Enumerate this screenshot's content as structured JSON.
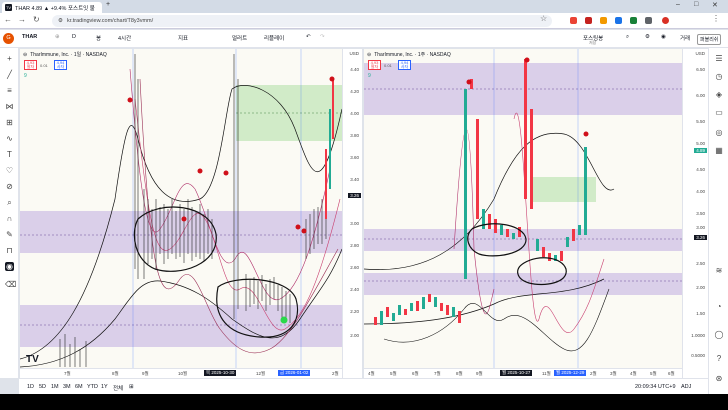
{
  "browser": {
    "tab_title": "THAR 4.89 ▲ +9.4% 포스트잇 불",
    "tab_favicon": "TV",
    "url": "kr.tradingview.com/chart/T8y3vmm/"
  },
  "toolbar": {
    "avatar": "G",
    "symbol": "THAR",
    "interval": "D",
    "candles_label": "봉",
    "compare_label": "4시간",
    "indicators_label": "지표",
    "alerts_label": "얼러트",
    "replay_label": "리플레이",
    "layout_label": "포스팅봉",
    "layout_sub": "저장",
    "trade_label": "거래",
    "publish_label": "퍼블리쉬"
  },
  "left_chart": {
    "title": "TharImmune, Inc. · 1일 · NASDAQ",
    "sell_price": "4.93",
    "sell_label": "팔자",
    "spread": "0.01",
    "buy_price": "4.94",
    "buy_label": "사자",
    "volume": "9",
    "currency": "USD",
    "y_ticks": [
      "4.40",
      "4.20",
      "4.00",
      "3.80",
      "3.60",
      "3.40",
      "3.26",
      "3.00",
      "2.80",
      "2.60",
      "2.40",
      "2.20",
      "2.00"
    ],
    "price_tag": "3.26",
    "x_ticks": [
      "7월",
      "8월",
      "9월",
      "10월",
      "12월",
      "2월"
    ],
    "x_highlight_1": "목 2025-10-30",
    "x_highlight_2": "금 2026-01-02"
  },
  "right_chart": {
    "title": "TharImmune, Inc. · 1주 · NASDAQ",
    "sell_price": "4.93",
    "sell_label": "팔자",
    "spread": "0.01",
    "buy_price": "4.94",
    "buy_label": "사자",
    "volume": "9",
    "currency": "USD",
    "y_ticks": [
      "6.50",
      "6.00",
      "5.50",
      "5.00",
      "4.89",
      "4.50",
      "4.00",
      "3.50",
      "3.26",
      "3.00",
      "2.50",
      "2.00",
      "1.50",
      "1.0000",
      "0.5000"
    ],
    "price_tag_1": "4.89",
    "price_tag_2": "3.26",
    "x_ticks": [
      "4월",
      "5월",
      "6월",
      "7월",
      "8월",
      "9월",
      "11월",
      "2월",
      "3월",
      "4월",
      "5월",
      "6월"
    ],
    "x_highlight_1": "월 2025-10-27",
    "x_highlight_2": "월 2025-12-29"
  },
  "bottom": {
    "timeframes": [
      "1D",
      "5D",
      "1M",
      "3M",
      "6M",
      "YTD",
      "1Y",
      "전체"
    ],
    "clock": "20:09:34 UTC+9",
    "adj": "ADJ"
  },
  "colors": {
    "up": "#22ab94",
    "down": "#f23645",
    "purple_zone": "#c8b5e3",
    "green_zone": "#b7e4b0",
    "accent": "#2962ff"
  }
}
